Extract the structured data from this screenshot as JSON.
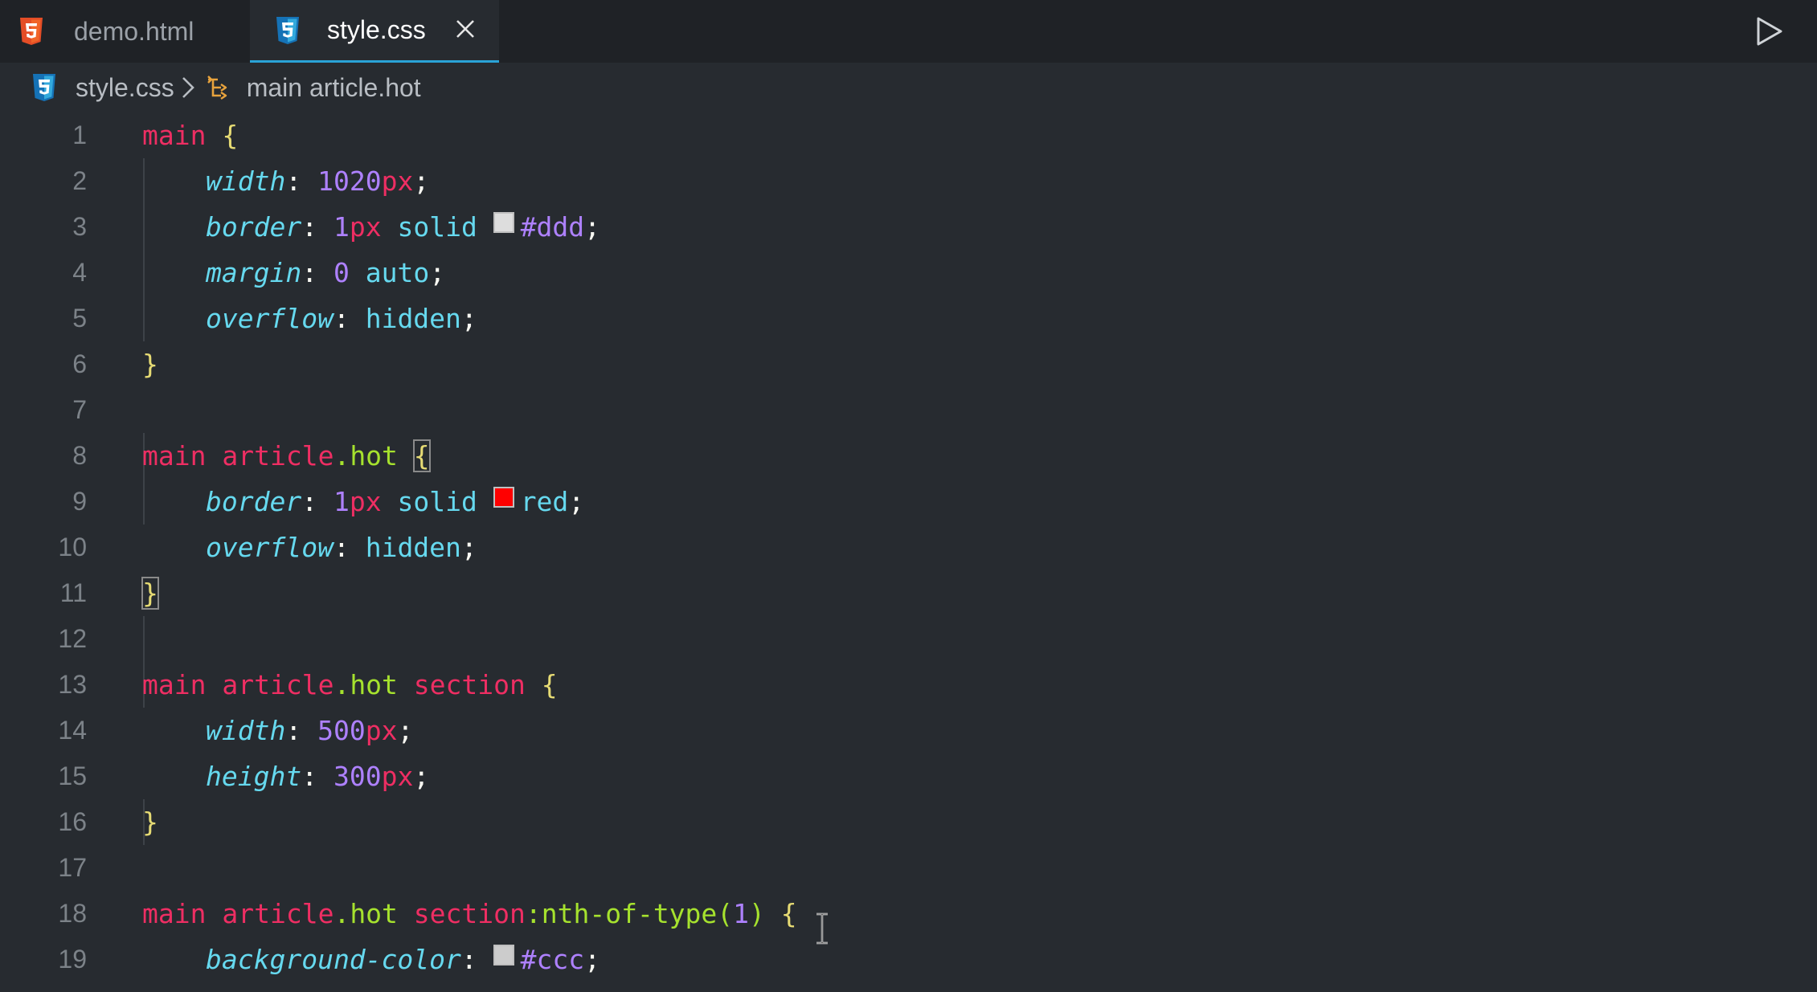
{
  "tabs": [
    {
      "label": "demo.html",
      "icon": "html5-icon",
      "active": false
    },
    {
      "label": "style.css",
      "icon": "css3-icon",
      "active": true
    }
  ],
  "breadcrumb": {
    "file": "style.css",
    "symbol": "main article.hot"
  },
  "colors": {
    "accent": "#2aa3d6",
    "html_icon": "#e44d26",
    "css_icon": "#1572b6"
  },
  "editor": {
    "lines": [
      {
        "n": "1",
        "code": "main {"
      },
      {
        "n": "2",
        "code": "width: 1020px;"
      },
      {
        "n": "3",
        "code": "border: 1px solid #ddd;"
      },
      {
        "n": "4",
        "code": "margin: 0 auto;"
      },
      {
        "n": "5",
        "code": "overflow: hidden;"
      },
      {
        "n": "6",
        "code": "}"
      },
      {
        "n": "7",
        "code": ""
      },
      {
        "n": "8",
        "code": "main article.hot {"
      },
      {
        "n": "9",
        "code": "border: 1px solid red;"
      },
      {
        "n": "10",
        "code": "overflow: hidden;"
      },
      {
        "n": "11",
        "code": "}"
      },
      {
        "n": "12",
        "code": ""
      },
      {
        "n": "13",
        "code": "main article.hot section {"
      },
      {
        "n": "14",
        "code": "width: 500px;"
      },
      {
        "n": "15",
        "code": "height: 300px;"
      },
      {
        "n": "16",
        "code": "}"
      },
      {
        "n": "17",
        "code": ""
      },
      {
        "n": "18",
        "code": "main article.hot section:nth-of-type(1) {"
      },
      {
        "n": "19",
        "code": "background-color: #ccc;"
      }
    ],
    "tokens": {
      "main": "main",
      "article": "article",
      "dot": ".",
      "hot": "hot",
      "section": "section",
      "open_brace": "{",
      "close_brace": "}",
      "colon": ":",
      "semi": ";",
      "p_width": "width",
      "p_border": "border",
      "p_margin": "margin",
      "p_overflow": "overflow",
      "p_height": "height",
      "p_background": "background-color",
      "n_1020": "1020",
      "n_1": "1",
      "n_0": "0",
      "n_500": "500",
      "n_300": "300",
      "u_px": "px",
      "v_solid": "solid",
      "v_auto": "auto",
      "v_hidden": "hidden",
      "v_red": "red",
      "c_ddd": "#ddd",
      "c_ccc": "#ccc",
      "pseudo_nth": ":nth-of-type(",
      "paren_num": "1",
      "paren_close": ")"
    }
  }
}
